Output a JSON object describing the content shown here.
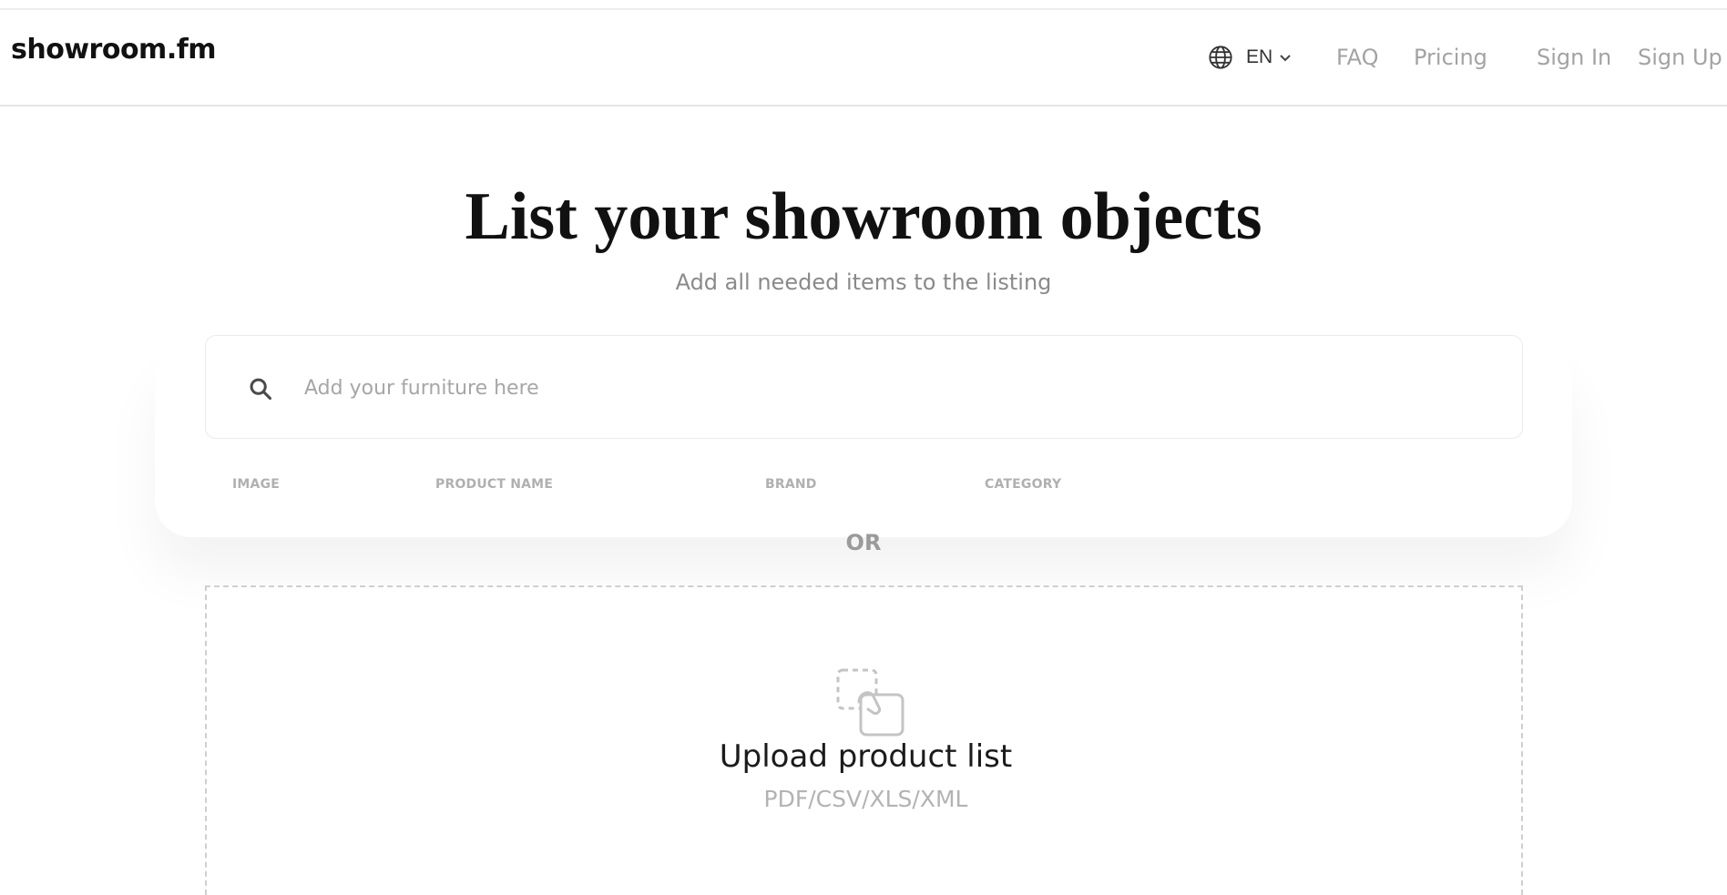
{
  "header": {
    "logo": "showroom.fm",
    "language": "EN",
    "nav": {
      "faq": "FAQ",
      "pricing": "Pricing",
      "sign_in": "Sign In",
      "sign_up": "Sign Up"
    }
  },
  "main": {
    "title": "List your showroom objects",
    "subtitle": "Add all needed items to the listing",
    "search": {
      "placeholder": "Add your furniture here",
      "value": ""
    },
    "table": {
      "columns": [
        "IMAGE",
        "PRODUCT NAME",
        "BRAND",
        "CATEGORY"
      ]
    },
    "divider": "OR",
    "upload": {
      "title": "Upload product list",
      "formats": "PDF/CSV/XLS/XML"
    }
  },
  "icons": {
    "language": "globe-icon",
    "dropdown": "chevron-down-icon",
    "search": "search-icon",
    "upload": "drag-file-icon"
  },
  "colors": {
    "text_primary": "#111111",
    "nav_link": "#a3a3a3",
    "muted": "#b0b0b0"
  }
}
